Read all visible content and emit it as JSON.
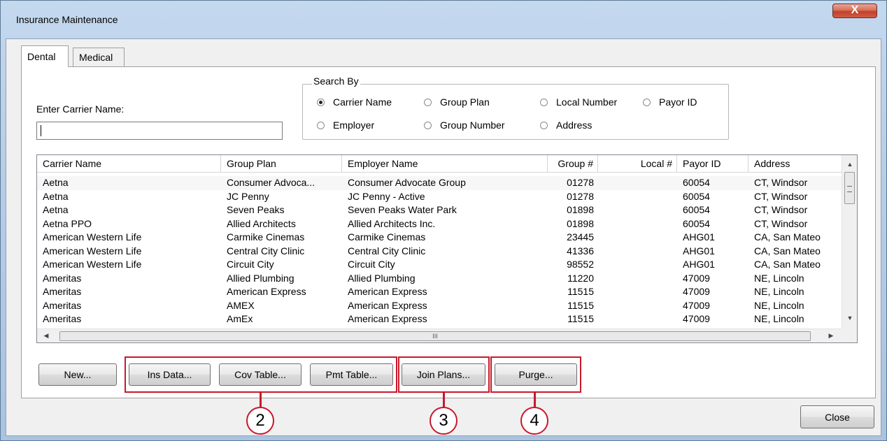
{
  "window": {
    "title": "Insurance Maintenance",
    "close_glyph": "X"
  },
  "tabs": [
    {
      "label": "Dental",
      "active": true
    },
    {
      "label": "Medical",
      "active": false
    }
  ],
  "search": {
    "carrier_label": "Enter Carrier Name:",
    "carrier_value": "",
    "group_title": "Search By",
    "options": [
      {
        "label": "Carrier Name",
        "selected": true
      },
      {
        "label": "Group Plan",
        "selected": false
      },
      {
        "label": "Local Number",
        "selected": false
      },
      {
        "label": "Payor ID",
        "selected": false
      },
      {
        "label": "Employer",
        "selected": false
      },
      {
        "label": "Group Number",
        "selected": false
      },
      {
        "label": "Address",
        "selected": false
      }
    ]
  },
  "table": {
    "columns": [
      "Carrier Name",
      "Group Plan",
      "Employer Name",
      "Group #",
      "Local #",
      "Payor ID",
      "Address"
    ],
    "rows": [
      [
        "Aetna",
        "Consumer Advoca...",
        "Consumer Advocate Group",
        "01278",
        "",
        "60054",
        "CT, Windsor"
      ],
      [
        "Aetna",
        "JC Penny",
        "JC Penny - Active",
        "01278",
        "",
        "60054",
        "CT, Windsor"
      ],
      [
        "Aetna",
        "Seven Peaks",
        "Seven Peaks Water Park",
        "01898",
        "",
        "60054",
        "CT, Windsor"
      ],
      [
        "Aetna PPO",
        "Allied Architects",
        "Allied Architects Inc.",
        "01898",
        "",
        "60054",
        "CT, Windsor"
      ],
      [
        "American Western Life",
        "Carmike Cinemas",
        "Carmike Cinemas",
        "23445",
        "",
        "AHG01",
        "CA, San Mateo"
      ],
      [
        "American Western Life",
        "Central City Clinic",
        "Central City Clinic",
        "41336",
        "",
        "AHG01",
        "CA, San Mateo"
      ],
      [
        "American Western Life",
        "Circuit City",
        "Circuit City",
        "98552",
        "",
        "AHG01",
        "CA, San Mateo"
      ],
      [
        "Ameritas",
        "Allied Plumbing",
        "Allied Plumbing",
        "11220",
        "",
        "47009",
        "NE, Lincoln"
      ],
      [
        "Ameritas",
        "American Express",
        "American Express",
        "11515",
        "",
        "47009",
        "NE, Lincoln"
      ],
      [
        "Ameritas",
        "AMEX",
        "American Express",
        "11515",
        "",
        "47009",
        "NE, Lincoln"
      ],
      [
        "Ameritas",
        "AmEx",
        "American Express",
        "11515",
        "",
        "47009",
        "NE, Lincoln"
      ]
    ],
    "hscroll_grip": "III"
  },
  "buttons": {
    "new": "New...",
    "ins_data": "Ins Data...",
    "cov_table": "Cov Table...",
    "pmt_table": "Pmt Table...",
    "join_plans": "Join Plans...",
    "purge": "Purge...",
    "close": "Close"
  },
  "callouts": [
    "2",
    "3",
    "4"
  ],
  "colors": {
    "callout_red": "#c8192b",
    "titlebar": "#b6cde6",
    "close_button": "#c4402a"
  }
}
